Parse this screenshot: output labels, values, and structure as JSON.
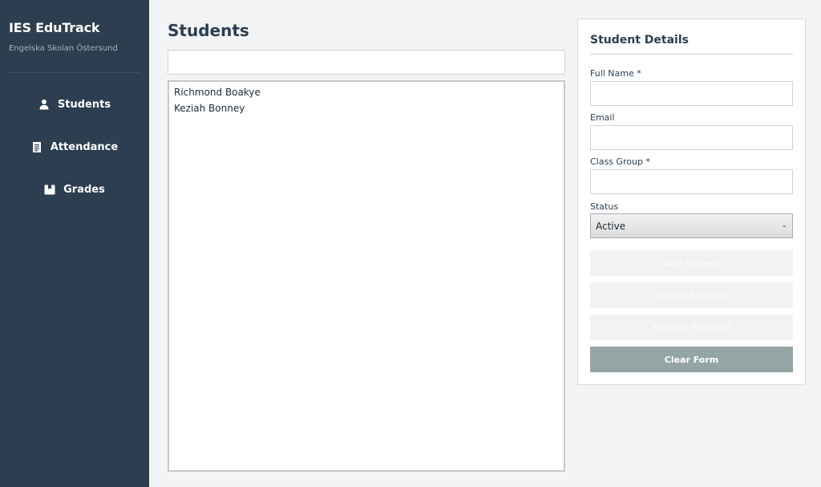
{
  "sidebar": {
    "app_title": "IES EduTrack",
    "school_name": "Engelska Skolan Östersund",
    "items": [
      {
        "label": "Students",
        "icon": "user-icon"
      },
      {
        "label": "Attendance",
        "icon": "clipboard-icon"
      },
      {
        "label": "Grades",
        "icon": "grades-icon"
      }
    ]
  },
  "main": {
    "title": "Students",
    "search": {
      "value": "",
      "placeholder": ""
    },
    "students": [
      "Richmond Boakye",
      "Keziah Bonney"
    ]
  },
  "details": {
    "title": "Student Details",
    "full_name_label": "Full Name *",
    "full_name_value": "",
    "email_label": "Email",
    "email_value": "",
    "class_group_label": "Class Group *",
    "class_group_value": "",
    "status_label": "Status",
    "status_value": "Active",
    "add_label": "Add Student",
    "update_label": "Update Selected",
    "remove_label": "Remove Selected",
    "clear_label": "Clear Form"
  },
  "colors": {
    "sidebar_bg": "#2c3e50",
    "clear_button": "#95a5a6",
    "page_bg": "#f3f4f6"
  }
}
